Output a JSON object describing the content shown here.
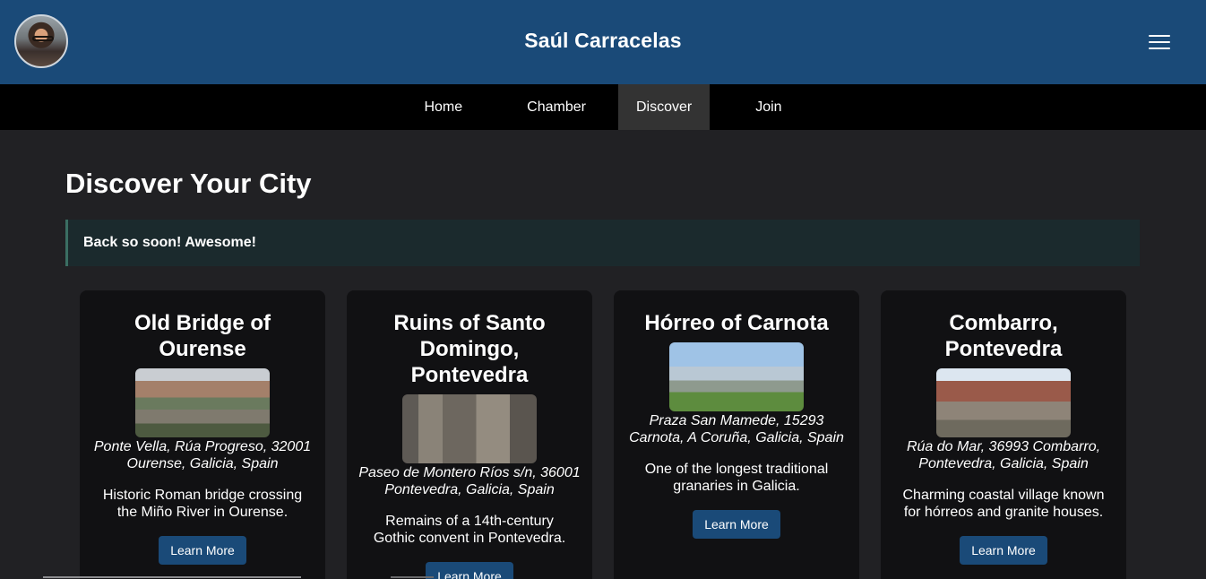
{
  "header": {
    "title": "Saúl Carracelas"
  },
  "nav": {
    "items": [
      "Home",
      "Chamber",
      "Discover",
      "Join"
    ],
    "active": "Discover"
  },
  "main": {
    "title": "Discover Your City",
    "notice": "Back so soon! Awesome!"
  },
  "cards": [
    {
      "title": "Old Bridge of Ourense",
      "address": "Ponte Vella, Rúa Progreso, 32001 Ourense, Galicia, Spain",
      "description": "Historic Roman bridge crossing the Miño River in Ourense.",
      "button": "Learn More"
    },
    {
      "title": "Ruins of Santo Domingo, Pontevedra",
      "address": "Paseo de Montero Ríos s/n, 36001 Pontevedra, Galicia, Spain",
      "description": "Remains of a 14th-century Gothic convent in Pontevedra.",
      "button": "Learn More"
    },
    {
      "title": "Hórreo of Carnota",
      "address": "Praza San Mamede, 15293 Carnota, A Coruña, Galicia, Spain",
      "description": "One of the longest traditional granaries in Galicia.",
      "button": "Learn More"
    },
    {
      "title": "Combarro, Pontevedra",
      "address": "Rúa do Mar, 36993 Combarro, Pontevedra, Galicia, Spain",
      "description": "Charming coastal village known for hórreos and granite houses.",
      "button": "Learn More"
    }
  ],
  "colors": {
    "header": "#1a4a78",
    "nav": "#000000",
    "body": "#212124",
    "card": "#111113",
    "button": "#1a4a78"
  }
}
